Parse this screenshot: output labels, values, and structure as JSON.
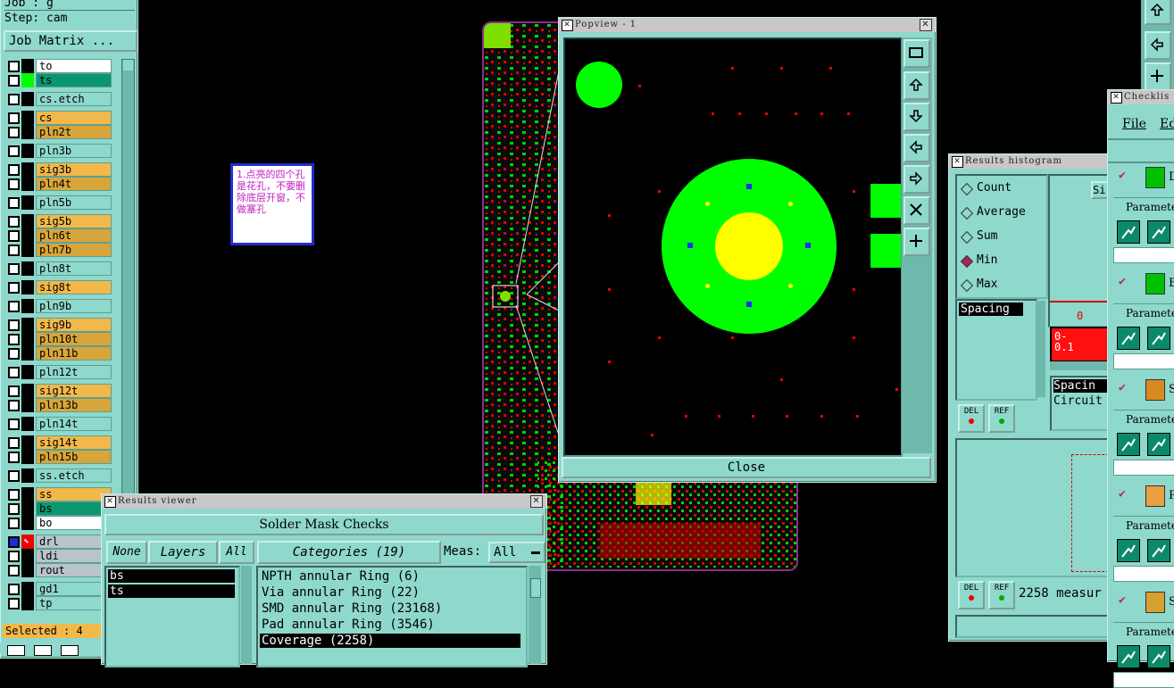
{
  "job": {
    "job_label": "Job : g",
    "step_label": "Step: cam",
    "matrix_button": "Job Matrix ..."
  },
  "layers": [
    {
      "name": "to",
      "color": "#ffffff"
    },
    {
      "name": "ts",
      "color": "#0c9670"
    },
    {
      "name": "cs.etch",
      "color": "#8fd8cc"
    },
    {
      "name": "cs",
      "color": "#f2b84a"
    },
    {
      "name": "pln2t",
      "color": "#d8a53a"
    },
    {
      "name": "pln3b",
      "color": "#8fd8cc"
    },
    {
      "name": "sig3b",
      "color": "#f2b84a"
    },
    {
      "name": "pln4t",
      "color": "#d8a53a"
    },
    {
      "name": "pln5b",
      "color": "#8fd8cc"
    },
    {
      "name": "sig5b",
      "color": "#f2b84a"
    },
    {
      "name": "pln6t",
      "color": "#d8a53a"
    },
    {
      "name": "pln7b",
      "color": "#d8a53a"
    },
    {
      "name": "pln8t",
      "color": "#8fd8cc"
    },
    {
      "name": "sig8t",
      "color": "#f2b84a"
    },
    {
      "name": "pln9b",
      "color": "#8fd8cc"
    },
    {
      "name": "sig9b",
      "color": "#f2b84a"
    },
    {
      "name": "pln10t",
      "color": "#d8a53a"
    },
    {
      "name": "pln11b",
      "color": "#d8a53a"
    },
    {
      "name": "pln12t",
      "color": "#8fd8cc"
    },
    {
      "name": "sig12t",
      "color": "#f2b84a"
    },
    {
      "name": "pln13b",
      "color": "#d8a53a"
    },
    {
      "name": "pln14t",
      "color": "#8fd8cc"
    },
    {
      "name": "sig14t",
      "color": "#f2b84a"
    },
    {
      "name": "pln15b",
      "color": "#d8a53a"
    },
    {
      "name": "ss.etch",
      "color": "#8fd8cc"
    },
    {
      "name": "ss",
      "color": "#f2b84a"
    },
    {
      "name": "bs",
      "color": "#0c9670"
    },
    {
      "name": "bo",
      "color": "#ffffff"
    },
    {
      "name": "drl",
      "color": "#b8c4c8"
    },
    {
      "name": "ldi",
      "color": "#b8c4c8"
    },
    {
      "name": "rout",
      "color": "#b8c4c8"
    },
    {
      "name": "gd1",
      "color": "#8fd8cc"
    },
    {
      "name": "tp",
      "color": "#8fd8cc"
    }
  ],
  "selected_label": "Selected : 4",
  "note": {
    "text": "1.点亮的四个孔是花孔，不要删除底层开窗，不做塞孔"
  },
  "popview": {
    "title": "Popview - 1",
    "close_button": "Close"
  },
  "results_viewer": {
    "title": "Results viewer",
    "header": "Solder Mask Checks",
    "none_button": "None",
    "layers_button": "Layers",
    "all_button": "All",
    "categories_label": "Categories (19)",
    "meas_label": "Meas:",
    "meas_value": "All",
    "layer_items": [
      "bs",
      "ts"
    ],
    "categories": [
      "NPTH annular Ring (6)",
      "Via annular Ring (22)",
      "SMD annular Ring (23168)",
      "Pad annular Ring (3546)",
      "Coverage (2258)"
    ]
  },
  "histogram": {
    "title": "Results histogram",
    "options": [
      "Count",
      "Average",
      "Sum",
      "Min",
      "Max"
    ],
    "selected_option": "Min",
    "list_item": "Spacing",
    "bar_zero": "0",
    "bar_range": "0-\n0.1",
    "info_line1": "Spacin",
    "info_line2": "Circuit",
    "del_label": "DEL",
    "ref_label": "REF",
    "measure_text": "2258 measur",
    "si_label": "Si"
  },
  "checklist": {
    "title": "Checklis",
    "menu_file": "File",
    "menu_edit": "Ed",
    "param_label": "Paramete",
    "items": [
      "D",
      "B",
      "S",
      "P",
      "S"
    ]
  },
  "colors": {
    "teal": "#8fd8cc",
    "green": "#00ff00",
    "yellow": "#ffff00",
    "red": "#e00000"
  }
}
